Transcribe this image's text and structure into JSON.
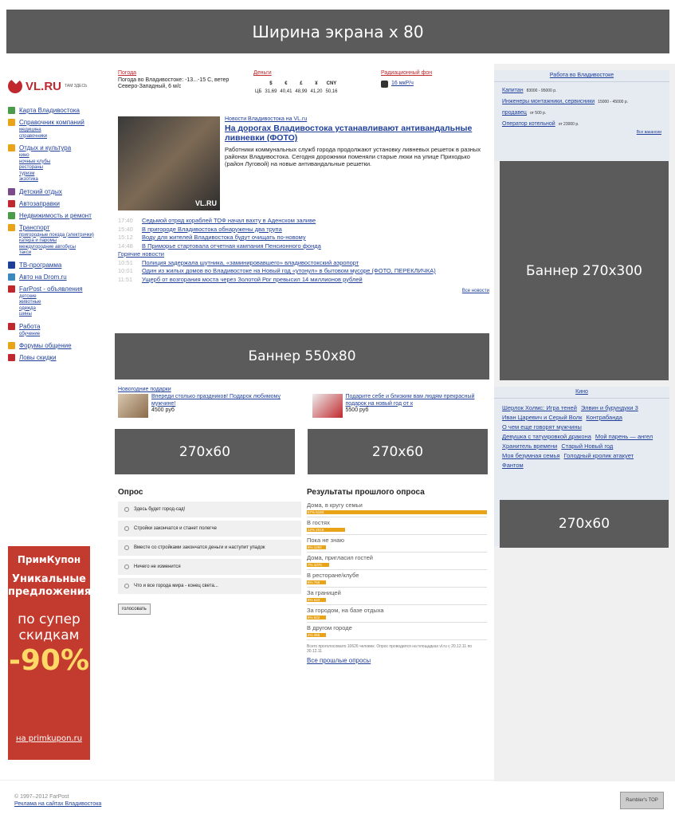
{
  "top_banner": "Ширина экрана х 80",
  "logo": {
    "text": "VL.RU",
    "sub": "ТАМ ЗДЕСЬ"
  },
  "left_nav": [
    {
      "label": "Карта Владивостока",
      "color": "#4a9b4a",
      "sub": []
    },
    {
      "label": "Справочник компаний",
      "color": "#e8a317",
      "sub": [
        "медицина",
        "справочники"
      ]
    },
    {
      "label": "Отдых и культура",
      "color": "#e8a317",
      "sub": [
        "кино",
        "ночные клубы",
        "рестораны",
        "туризм",
        "экзотика"
      ]
    },
    {
      "label": "Детский отдых",
      "color": "#7a4a8a",
      "sub": []
    },
    {
      "label": "Автозаправки",
      "color": "#c0282d",
      "sub": []
    },
    {
      "label": "Недвижимость и ремонт",
      "color": "#4a9b4a",
      "sub": []
    },
    {
      "label": "Транспорт",
      "color": "#e8a317",
      "sub": [
        "пригородные поезда (электрички)",
        "катера и паромы",
        "междугородние автобусы",
        "такси"
      ]
    },
    {
      "label": "ТВ-программа",
      "color": "#1f3f9b",
      "sub": []
    },
    {
      "label": "Авто на Drom.ru",
      "color": "#3a8ac0",
      "sub": []
    },
    {
      "label": "FarPost - объявления",
      "color": "#c0282d",
      "sub": [
        "детские",
        "животные",
        "одежда",
        "шины"
      ]
    },
    {
      "label": "Работа",
      "color": "#c0282d",
      "sub": [
        "обучение"
      ]
    },
    {
      "label": "Форумы общение",
      "color": "#e8a317",
      "sub": []
    },
    {
      "label": "Ловы скидки",
      "color": "#c0282d",
      "sub": []
    }
  ],
  "promo": {
    "brand": "ПримКупон",
    "line1": "Уникальные предложения",
    "line2": "по супер скидкам",
    "percent": "-90%",
    "site": "на primkupon.ru"
  },
  "weather": {
    "header": "Погода",
    "text": "Погода во Владивостоке: -13...-15 С, ветер Северо-Западный, 6 м/с"
  },
  "money": {
    "header": "Деньги",
    "symbols": [
      "$",
      "€",
      "£",
      "¥",
      "CNY"
    ],
    "bank": "ЦБ",
    "values": [
      "31,69",
      "40,41",
      "48,99",
      "41,20",
      "50,16"
    ]
  },
  "radiation": {
    "header": "Радиационный фон",
    "value": "16 мкР/ч"
  },
  "main_news": {
    "section": "Новости Владивостока на VL.ru",
    "title": "На дорогах Владивостока устанавливают антивандальные ливневки (ФОТО)",
    "body": "Работники коммунальных служб города продолжают установку ливневых решеток в разных районах Владивостока. Сегодня дорожники поменяли старые люки на улице Приходько (район Луговой) на новые антивандальные решетки.",
    "watermark": "VL.RU"
  },
  "news_list": [
    {
      "time": "17:40",
      "text": "Седьмой отряд кораблей ТОФ начал вахту в Аденском заливе"
    },
    {
      "time": "15:40",
      "text": "В пригороде Владивостока обнаружены два трупа"
    },
    {
      "time": "15:12",
      "text": "Воду для жителей Владивостока будут очищать по-новому"
    },
    {
      "time": "14:48",
      "text": "В Приморье стартовала отчетная кампания Пенсионного фонда"
    }
  ],
  "hot_header": "Горячие новости",
  "hot_news": [
    {
      "time": "10:51",
      "text": "Полиция задержала шутника, «заминировавшего» владивостокский аэропорт"
    },
    {
      "time": "10:01",
      "text": "Один из жилых домов во Владивостоке на Новый год «утонул» в бытовом мусоре (ФОТО, ПЕРЕКЛИЧКА)"
    },
    {
      "time": "11:51",
      "text": "Ущерб от возгорания моста через Золотой Рог превысил 14 миллионов рублей"
    }
  ],
  "all_news": "Все новости",
  "banner_550": "Баннер 550x80",
  "gifts": {
    "header": "Новогодние подарки",
    "items": [
      {
        "title": "Впереди столько праздников! Подарок любимому мужчине!",
        "price": "4500 руб"
      },
      {
        "title": "Подарите себе и близким вам людям прекрасный подарок на новый год от к",
        "price": "5500 руб"
      }
    ]
  },
  "banner_60a": "270x60",
  "banner_60b": "270x60",
  "banner_60c": "270x60",
  "banner_300": "Баннер 270x300",
  "poll": {
    "title": "Опрос",
    "options": [
      "Здесь будет город-сад!",
      "Стройки закончатся и станет полегче",
      "Вместе со стройками закончатся деньги и наступит упадок",
      "Ничего не изменится",
      "Что и все города мира - конец света..."
    ],
    "vote": "голосовать"
  },
  "results": {
    "title": "Результаты прошлого опроса",
    "items": [
      {
        "label": "Дома, в кругу семьи",
        "pct": 57,
        "text": "57% 6193"
      },
      {
        "label": "В гостях",
        "pct": 12,
        "text": "12% 2016"
      },
      {
        "label": "Пока не знаю",
        "pct": 6,
        "text": "6% 1292"
      },
      {
        "label": "Дома, пригласил гостей",
        "pct": 7,
        "text": "7% 1076"
      },
      {
        "label": "В ресторане/клубе",
        "pct": 6,
        "text": "6% 766"
      },
      {
        "label": "За границей",
        "pct": 6,
        "text": "6% 643"
      },
      {
        "label": "За городом, на базе отдыха",
        "pct": 6,
        "text": "6% 622"
      },
      {
        "label": "В другом городе",
        "pct": 4,
        "text": "4% 455"
      }
    ],
    "note": "Всего проголосовало 10626 человек. Опрос проводился на площадках vl.ru с 20.12.11 по 30.12.11",
    "all": "Все прошлые опросы"
  },
  "jobs": {
    "header": "Работа во Владивостоке",
    "items": [
      {
        "title": "Капитан",
        "salary": "83000 - 95000 р."
      },
      {
        "title": "Инженеры монтажники, сервисники",
        "salary": "15000 - 45000 р."
      },
      {
        "title": "продавец",
        "salary": "от 500 р."
      },
      {
        "title": "Оператор котельной",
        "salary": "от 23000 р."
      }
    ],
    "all": "Все вакансии"
  },
  "cinema": {
    "header": "Кино",
    "movies": [
      "Шерлок Холмс: Игра теней",
      "Элвин и бурундуки 3",
      "Иван Царевич и Серый Волк",
      "Контрабанда",
      "О чем еще говорят мужчины",
      "Девушка с татуировкой дракона",
      "Мой парень — ангел",
      "Хранитель времени",
      "Старый Новый год",
      "Моя безумная семья",
      "Голодный кролик атакует",
      "Фантом"
    ]
  },
  "footer": {
    "copyright": "© 1997–2012 FarPost",
    "ad": "Реклама на сайтах Владивостока",
    "badge": "Rambler's TOP"
  }
}
